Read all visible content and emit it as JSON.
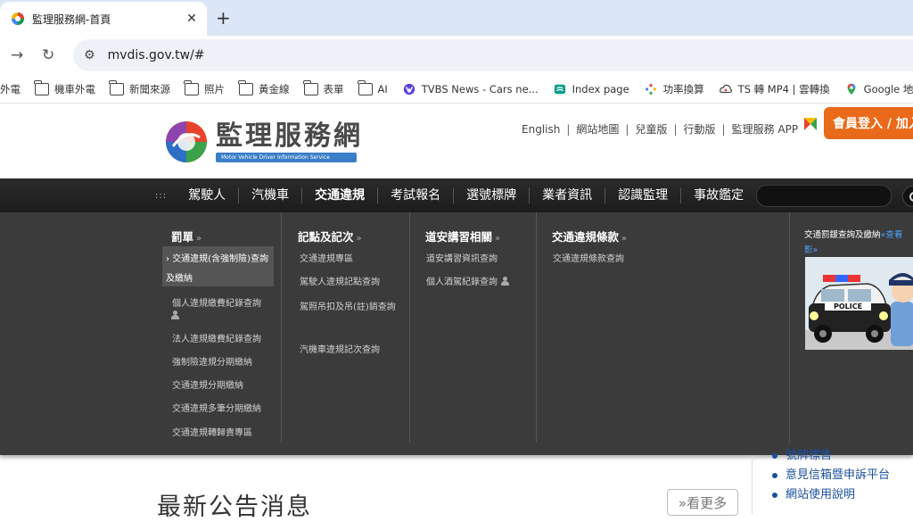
{
  "browser": {
    "tab_title": "監理服務網-首頁",
    "tab_close": "✕",
    "new_tab": "+",
    "back": "→",
    "reload": "↻",
    "tune": "⚙",
    "url": "mvdis.gov.tw/#",
    "bookmarks": [
      {
        "label": "外電",
        "icon": "none"
      },
      {
        "label": "機車外電",
        "icon": "folder-icon"
      },
      {
        "label": "新聞來源",
        "icon": "folder-icon"
      },
      {
        "label": "照片",
        "icon": "folder-icon"
      },
      {
        "label": "黃金線",
        "icon": "folder-icon"
      },
      {
        "label": "表單",
        "icon": "folder-icon"
      },
      {
        "label": "AI",
        "icon": "folder-icon"
      },
      {
        "label": "TVBS News - Cars ne...",
        "icon": "tvbs-icon"
      },
      {
        "label": "Index page",
        "icon": "index-page-icon"
      },
      {
        "label": "功率換算",
        "icon": "sparkle-icon"
      },
      {
        "label": "TS 轉 MP4 | 雲轉換",
        "icon": "cloud-icon"
      },
      {
        "label": "Google 地圖",
        "icon": "google-maps-icon"
      }
    ]
  },
  "header": {
    "logo_cn": "監理服務網",
    "logo_en": "Motor Vehicle Driver Information Service",
    "toplinks": [
      "English",
      "網站地圖",
      "兒童版",
      "行動版",
      "監理服務 APP"
    ],
    "separator": "|",
    "login": "會員登入 / 加入"
  },
  "nav": {
    "grip": ":::",
    "items": [
      "駕駛人",
      "汽機車",
      "交通違規",
      "考試報名",
      "選號標牌",
      "業者資訊",
      "認識監理",
      "事故鑑定"
    ],
    "active_index": 2
  },
  "mega": {
    "raquo": "»",
    "columns": [
      {
        "title": "罰單",
        "items": [
          {
            "label": "交通違規(含強制險)查詢及繳納",
            "prefix": "›",
            "selected": true
          },
          {
            "label": "個人違規繳費紀錄查詢",
            "user": true
          },
          {
            "label": "法人違規繳費紀錄查詢"
          },
          {
            "label": "強制險違規分期繳納"
          },
          {
            "label": "交通違規分期繳納"
          },
          {
            "label": "交通違規多筆分期繳納"
          },
          {
            "label": "交通違規轉歸責專區"
          }
        ]
      },
      {
        "title": "記點及記次",
        "items": [
          {
            "label": "交通違規專區"
          },
          {
            "label": "駕駛人違規記點查詢"
          },
          {
            "label": "駕照吊扣及吊(註)銷查詢"
          },
          {
            "label": "汽機車違規記次查詢"
          }
        ]
      },
      {
        "title": "道安講習相關",
        "items": [
          {
            "label": "道安講習資訊查詢"
          },
          {
            "label": "個人酒駕紀錄查詢",
            "user": true
          }
        ]
      },
      {
        "title": "交通違規條款",
        "items": [
          {
            "label": "交通違規條款查詢"
          }
        ]
      }
    ],
    "promo": {
      "title": "交通罰鍰查詢及繳納",
      "link": "«查看",
      "link2": "影»"
    }
  },
  "lower": {
    "links": [
      "號牌標售",
      "意見信箱暨申訴平台",
      "網站使用說明"
    ],
    "news_heading": "最新公告消息",
    "more": "»看更多"
  },
  "colors": {
    "nav_bg": "#1f1f1f",
    "mega_bg": "#3b3b3b",
    "login_orange": "#e96a1a",
    "link_blue": "#1a4f9c"
  }
}
